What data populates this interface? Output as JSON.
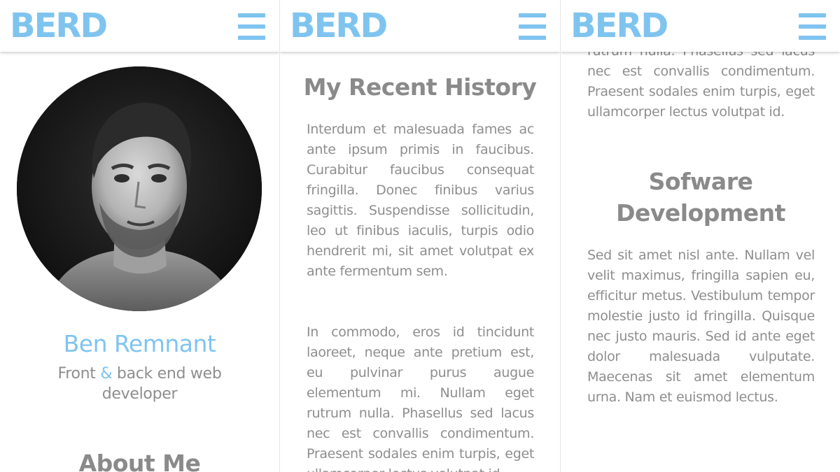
{
  "brand": {
    "logo": "BERD",
    "accent": "#7fc4ef",
    "menu_icon": "hamburger-menu-icon"
  },
  "profile": {
    "name": "Ben Remnant",
    "role_part1": "Front",
    "role_amp": "&",
    "role_part2": "back end web developer",
    "about_heading": "About Me",
    "photo": "portrait-photo"
  },
  "history": {
    "heading": "My Recent History",
    "para1": "Interdum et malesuada fames ac ante ipsum primis in faucibus. Curabitur faucibus consequat fringilla. Donec finibus varius sagittis. Suspendisse sollicitudin, leo ut finibus iaculis, turpis odio hendrerit mi, sit amet volutpat ex ante fermentum sem.",
    "para2": "In commodo, eros id tincidunt laoreet, neque ante pretium est, eu pulvinar purus augue elementum mi. Nullam eget rutrum nulla. Phasellus sed lacus nec est convallis condimentum. Praesent sodales enim turpis, eget ullamcorper lectus volutpat id."
  },
  "software": {
    "heading": "Sofware Development",
    "para": "Sed sit amet nisl ante. Nullam vel velit maximus, fringilla sapien eu, efficitur metus. Vestibulum tempor molestie justo id fringilla. Quisque nec justo mauris. Sed id ante eget dolor malesuada vulputate. Maecenas sit amet elementum urna. Nam et euismod lectus."
  }
}
